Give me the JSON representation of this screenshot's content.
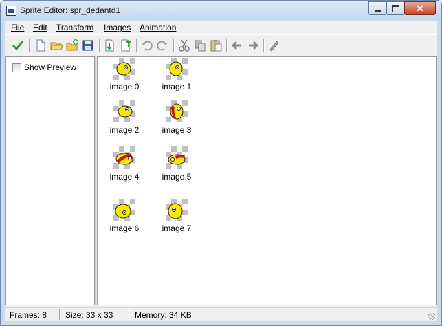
{
  "window": {
    "title": "Sprite Editor: spr_dedantd1"
  },
  "menu": [
    "File",
    "Edit",
    "Transform",
    "Images",
    "Animation"
  ],
  "toolbar": {
    "icons": [
      "checkmark-icon",
      "new-document-icon",
      "open-folder-icon",
      "add-from-file-icon",
      "save-icon",
      "import-down-icon",
      "export-up-icon",
      "undo-icon",
      "redo-icon",
      "cut-icon",
      "copy-icon",
      "paste-icon",
      "arrow-left-icon",
      "arrow-right-icon",
      "pencil-icon"
    ]
  },
  "options": {
    "show_preview_label": "Show Preview",
    "show_preview_checked": false
  },
  "images": [
    {
      "label": "image 0"
    },
    {
      "label": "image 1"
    },
    {
      "label": "image 2"
    },
    {
      "label": "image 3"
    },
    {
      "label": "image 4"
    },
    {
      "label": "image 5"
    },
    {
      "label": "image 6"
    },
    {
      "label": "image 7"
    }
  ],
  "status": {
    "frames": "Frames: 8",
    "size": "Size: 33 x 33",
    "memory": "Memory: 34 KB"
  },
  "colors": {
    "titlebar": "#c4d7ec",
    "sprite_yellow": "#f5e800",
    "sprite_red": "#cc1111",
    "accent_green": "#2e9b2e"
  }
}
